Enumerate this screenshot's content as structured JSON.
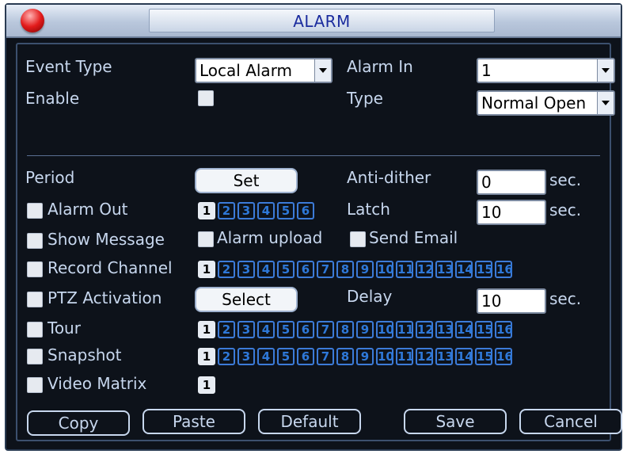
{
  "window": {
    "title": "ALARM"
  },
  "fields": {
    "event_type": {
      "label": "Event Type",
      "value": "Local Alarm"
    },
    "alarm_in": {
      "label": "Alarm In",
      "value": "1"
    },
    "enable": {
      "label": "Enable"
    },
    "type": {
      "label": "Type",
      "value": "Normal Open"
    },
    "period": {
      "label": "Period",
      "button": "Set"
    },
    "anti_dither": {
      "label": "Anti-dither",
      "value": "0",
      "unit": "sec."
    },
    "alarm_out": {
      "label": "Alarm Out",
      "channels": [
        "1",
        "2",
        "3",
        "4",
        "5",
        "6"
      ]
    },
    "latch": {
      "label": "Latch",
      "value": "10",
      "unit": "sec."
    },
    "show_message": {
      "label": "Show Message"
    },
    "alarm_upload": {
      "label": "Alarm upload"
    },
    "send_email": {
      "label": "Send Email"
    },
    "record_channel": {
      "label": "Record Channel",
      "channels": [
        "1",
        "2",
        "3",
        "4",
        "5",
        "6",
        "7",
        "8",
        "9",
        "10",
        "11",
        "12",
        "13",
        "14",
        "15",
        "16"
      ]
    },
    "ptz_activation": {
      "label": "PTZ Activation",
      "button": "Select"
    },
    "delay": {
      "label": "Delay",
      "value": "10",
      "unit": "sec."
    },
    "tour": {
      "label": "Tour",
      "channels": [
        "1",
        "2",
        "3",
        "4",
        "5",
        "6",
        "7",
        "8",
        "9",
        "10",
        "11",
        "12",
        "13",
        "14",
        "15",
        "16"
      ]
    },
    "snapshot": {
      "label": "Snapshot",
      "channels": [
        "1",
        "2",
        "3",
        "4",
        "5",
        "6",
        "7",
        "8",
        "9",
        "10",
        "11",
        "12",
        "13",
        "14",
        "15",
        "16"
      ]
    },
    "video_matrix": {
      "label": "Video Matrix",
      "channels": [
        "1"
      ]
    }
  },
  "buttons": {
    "copy": "Copy",
    "paste": "Paste",
    "default": "Default",
    "save": "Save",
    "cancel": "Cancel"
  },
  "colors": {
    "background": "#0d121a",
    "label": "#c7d7ee",
    "title": "#1b2c9e",
    "channel_blue": "#2e78d8"
  }
}
